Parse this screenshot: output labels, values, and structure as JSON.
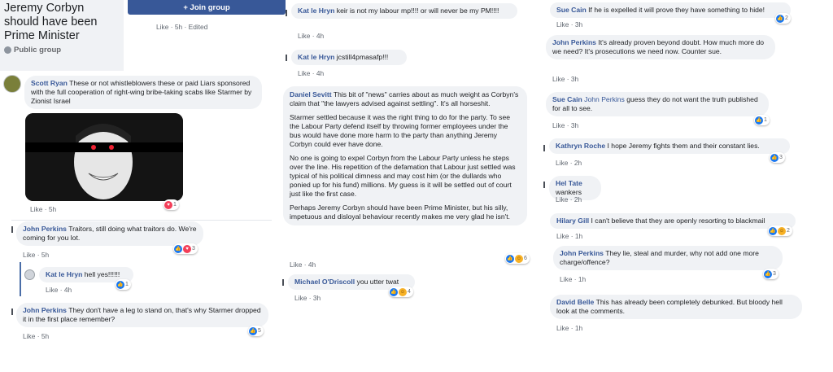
{
  "group": {
    "title": "Jeremy Corbyn should have been Prime Minister",
    "privacy": "Public group",
    "join_label": "+ Join group"
  },
  "post_meta": {
    "like": "Like",
    "dot": "·",
    "time": "5h",
    "edited": "Edited"
  },
  "col1": [
    {
      "author": "Scott Ryan",
      "text": "These or not whistleblowers these or paid Liars sponsored with the full cooperation of right-wing bribe-taking scabs like Starmer by Zionist Israel",
      "like": "Like",
      "time": "5h",
      "reactions": "1"
    },
    {
      "author": "John Perkins",
      "text": "Traitors, still doing what traitors do. We're coming for you lot.",
      "like": "Like",
      "time": "5h",
      "reactions": "3"
    },
    {
      "author": "Kat le Hryn",
      "text": "hell yes!!!!!!",
      "like": "Like",
      "time": "4h",
      "reactions": "1"
    },
    {
      "author": "John Perkins",
      "text": "They don't have a leg to stand on, that's why Starmer dropped it in the first place remember?",
      "like": "Like",
      "time": "5h",
      "reactions": "5"
    }
  ],
  "col2": [
    {
      "author": "Kat le Hryn",
      "text": "keir is not my labour mp!!!! or will never be my PM!!!!",
      "like": "Like",
      "time": "4h"
    },
    {
      "author": "Kat le Hryn",
      "text": "jcstill4pmasafp!!!",
      "like": "Like",
      "time": "4h"
    },
    {
      "author": "Daniel Sevitt",
      "paragraphs": [
        "This bit of \"news\" carries about as much weight as Corbyn's claim that \"the lawyers advised against settling\". It's all horseshit.",
        "Starmer settled because it was the right thing to do for the party. To see the Labour Party defend itself by throwing former employees under the bus would have done more harm to the party than anything Jeremy Corbyn could ever have done.",
        "No one is going to expel Corbyn from the Labour Party unless he steps over the line. His repetition of the defamation that Labour just settled was typical of his political dimness and may cost him (or the dullards who ponied up for his fund) millions. My guess is it will be settled out of court just like the first case.",
        "Perhaps Jeremy Corbyn should have been Prime Minister, but his silly, impetuous and disloyal behaviour recently makes me very glad he isn't."
      ],
      "like": "Like",
      "time": "4h",
      "reactions": "6"
    },
    {
      "author": "Michael O'Driscoll",
      "text": "you utter twat",
      "like": "Like",
      "time": "3h",
      "reactions": "4"
    }
  ],
  "col3": [
    {
      "author": "Sue Cain",
      "text": "If he is expelled it will prove they have something to hide!",
      "like": "Like",
      "time": "3h",
      "reactions": "2"
    },
    {
      "author": "John Perkins",
      "text": "It's already proven beyond doubt. How much more do we need? It's prosecutions we need now. Counter sue.",
      "like": "Like",
      "time": "3h"
    },
    {
      "author": "Sue Cain",
      "mention": "John Perkins",
      "text": "guess they do not want the truth published for all to see.",
      "like": "Like",
      "time": "3h",
      "reactions": "1"
    },
    {
      "author": "Kathryn Roche",
      "text": "I hope Jeremy fights them and their constant lies.",
      "like": "Like",
      "time": "2h",
      "reactions": "3"
    },
    {
      "author": "Hel Tate",
      "text": "wankers",
      "like": "Like",
      "time": "2h"
    },
    {
      "author": "Hilary Gill",
      "text": "I can't believe that they are openly resorting to blackmail",
      "like": "Like",
      "time": "1h",
      "reactions": "2"
    },
    {
      "author": "John Perkins",
      "text": "They lie, steal and murder, why not add one more charge/offence?",
      "like": "Like",
      "time": "1h",
      "reactions": "3"
    },
    {
      "author": "David Belle",
      "text": "This has already been completely debunked. But bloody hell look at the comments.",
      "like": "Like",
      "time": "1h"
    }
  ],
  "colors": {
    "name": "#385898",
    "bubble": "#f0f2f5",
    "meta": "#606770",
    "join": "#385898"
  }
}
